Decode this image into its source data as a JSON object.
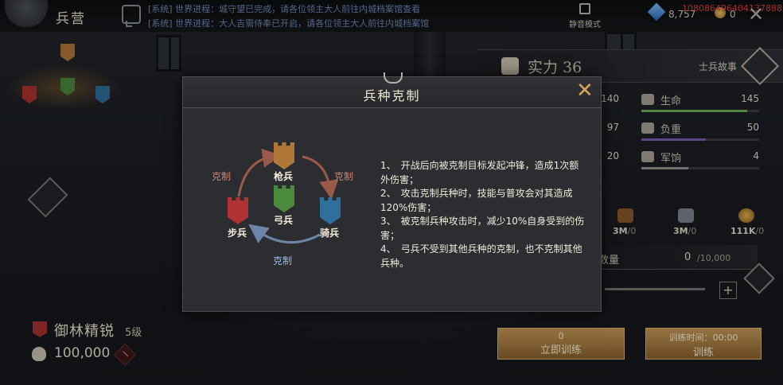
{
  "header": {
    "title": "兵营",
    "chat": [
      "[系统] 世界进程：城守望已完成，请各位领主大人前往内城档案馆查看",
      "[系统] 世界进程：大人吉需侍奉已开启，请各位领主大人前往内城档案馆"
    ],
    "mute_label": "静音模式",
    "gems": "8,757",
    "coins": "0",
    "debug_id": "108086496404137888"
  },
  "stats": {
    "power_label": "实力 36",
    "story_label": "士兵故事",
    "rows": [
      {
        "label": "生命",
        "value": "145",
        "left_value": "140",
        "fill": 0.9,
        "color": "#6fb25a"
      },
      {
        "label": "负重",
        "value": "50",
        "left_value": "97",
        "fill": 0.55,
        "color": "#7e5fb0"
      },
      {
        "label": "军饷",
        "value": "4",
        "left_value": "20",
        "fill": 0.4,
        "color": "#9a9a9a"
      }
    ],
    "resources": [
      {
        "value": "3M",
        "max": "/0"
      },
      {
        "value": "3M",
        "max": "/0"
      },
      {
        "value": "111K",
        "max": "/0"
      }
    ],
    "quantity_label": "数量",
    "quantity_value": "0",
    "quantity_max": "/10,000"
  },
  "actions": {
    "train_now_cost": "0",
    "train_now_label": "立即训练",
    "train_time_label": "训练时间：00:00",
    "train_label": "训练"
  },
  "unit": {
    "name": "御林精锐",
    "level": "5级",
    "count": "100,000"
  },
  "modal": {
    "title": "兵种克制",
    "spearman": "枪兵",
    "archer": "弓兵",
    "cavalry": "骑兵",
    "infantry": "步兵",
    "counter_label": "克制",
    "rules": [
      "1、　开战后向被克制目标发起冲锋，造成1次额外伤害；",
      "2、　攻击克制兵种时，技能与普攻会对其造成120%伤害；",
      "3、　被克制兵种攻击时，减少10%自身受到的伤害；",
      "4、　弓兵不受到其他兵种的克制，也不克制其他兵种。"
    ]
  },
  "colors": {
    "spearman": "#b07838",
    "archer": "#4a8a3c",
    "cavalry": "#2e6f9c",
    "infantry": "#b03232",
    "accent": "#d6a25c"
  }
}
